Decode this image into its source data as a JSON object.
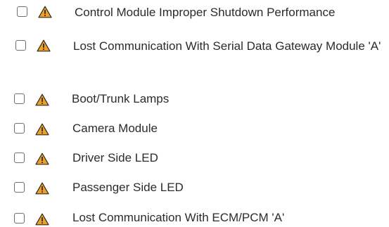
{
  "list": {
    "items": [
      {
        "label": "Control Module Improper Shutdown Performance",
        "checked": false,
        "icon": "warning-icon"
      },
      {
        "label": "Lost Communication With Serial Data Gateway Module 'A'",
        "checked": false,
        "icon": "warning-icon"
      },
      {
        "label": "Boot/Trunk Lamps",
        "checked": false,
        "icon": "warning-icon"
      },
      {
        "label": "Camera Module",
        "checked": false,
        "icon": "warning-icon"
      },
      {
        "label": "Driver Side LED",
        "checked": false,
        "icon": "warning-icon"
      },
      {
        "label": "Passenger Side LED",
        "checked": false,
        "icon": "warning-icon"
      },
      {
        "label": "Lost Communication With ECM/PCM 'A'",
        "checked": false,
        "icon": "warning-icon"
      }
    ]
  },
  "colors": {
    "warning_fill": "#f0a020",
    "warning_stroke": "#2b2b2b",
    "text": "#2b2b2b",
    "checkbox_border": "#6e6e6e"
  }
}
